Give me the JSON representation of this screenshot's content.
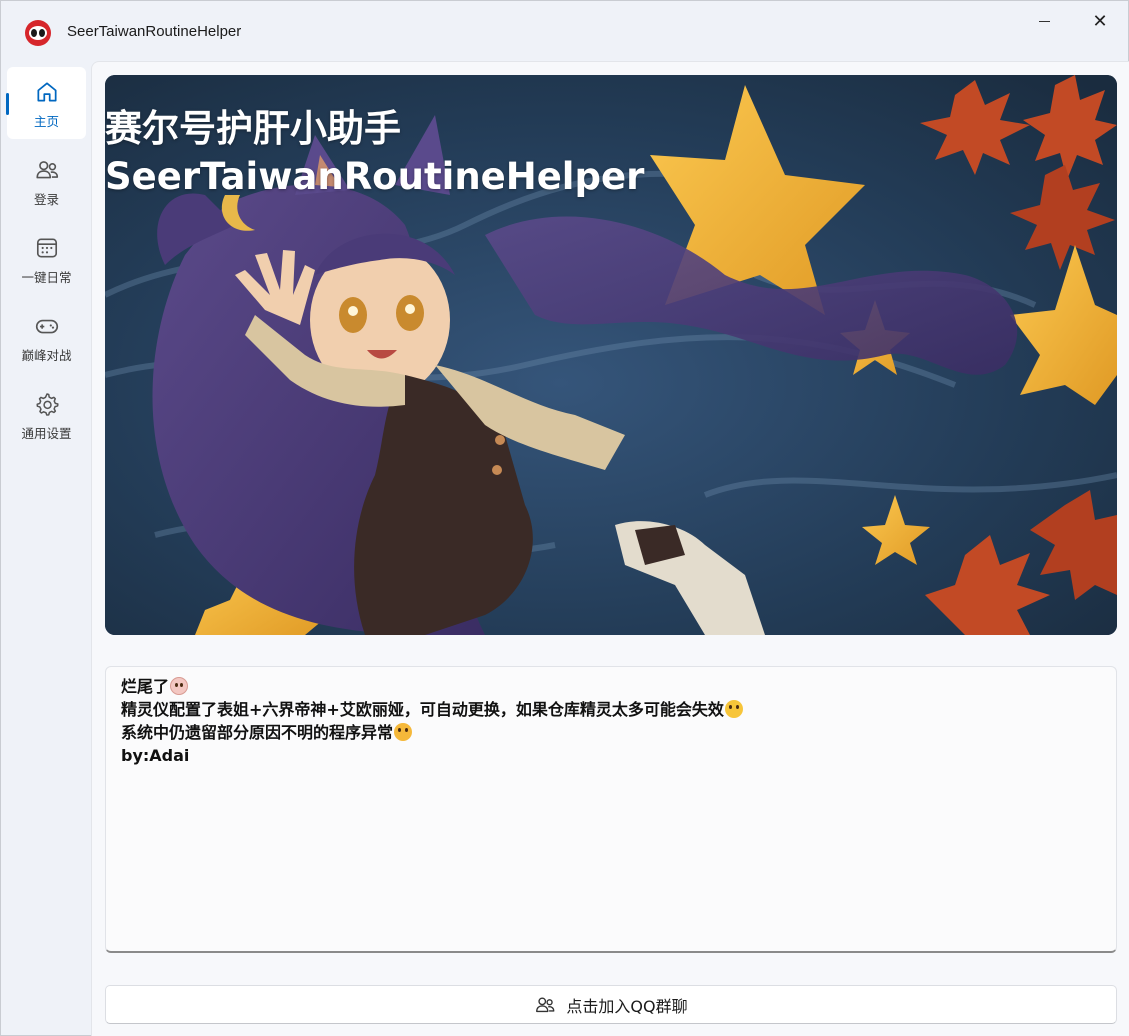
{
  "window": {
    "title": "SeerTaiwanRoutineHelper",
    "logo_icon": "seer-logo-icon",
    "minimize_icon": "minimize-icon",
    "close_icon": "close-icon",
    "close_glyph": "✕"
  },
  "sidebar": {
    "items": [
      {
        "label": "主页",
        "icon": "home-icon",
        "active": true
      },
      {
        "label": "登录",
        "icon": "people-icon",
        "active": false
      },
      {
        "label": "一键日常",
        "icon": "calendar-icon",
        "active": false
      },
      {
        "label": "巅峰对战",
        "icon": "gamepad-icon",
        "active": false
      },
      {
        "label": "通用设置",
        "icon": "gear-icon",
        "active": false
      }
    ],
    "accent_color": "#0067c0"
  },
  "banner": {
    "title_cn": "赛尔号护肝小助手",
    "title_en": "SeerTaiwanRoutineHelper"
  },
  "notice": {
    "lines": [
      {
        "text": "烂尾了",
        "emoji": "crying-face-emoji"
      },
      {
        "text": "精灵仪配置了表姐+六界帝神+艾欧丽娅，可自动更换，如果仓库精灵太多可能会失效",
        "emoji": "grinning-face-emoji"
      },
      {
        "text": "系统中仍遗留部分原因不明的程序异常",
        "emoji": "flushed-face-emoji"
      },
      {
        "text": "by:Adai",
        "emoji": ""
      }
    ]
  },
  "qq_button": {
    "label": "点击加入QQ群聊",
    "icon": "people-icon"
  }
}
